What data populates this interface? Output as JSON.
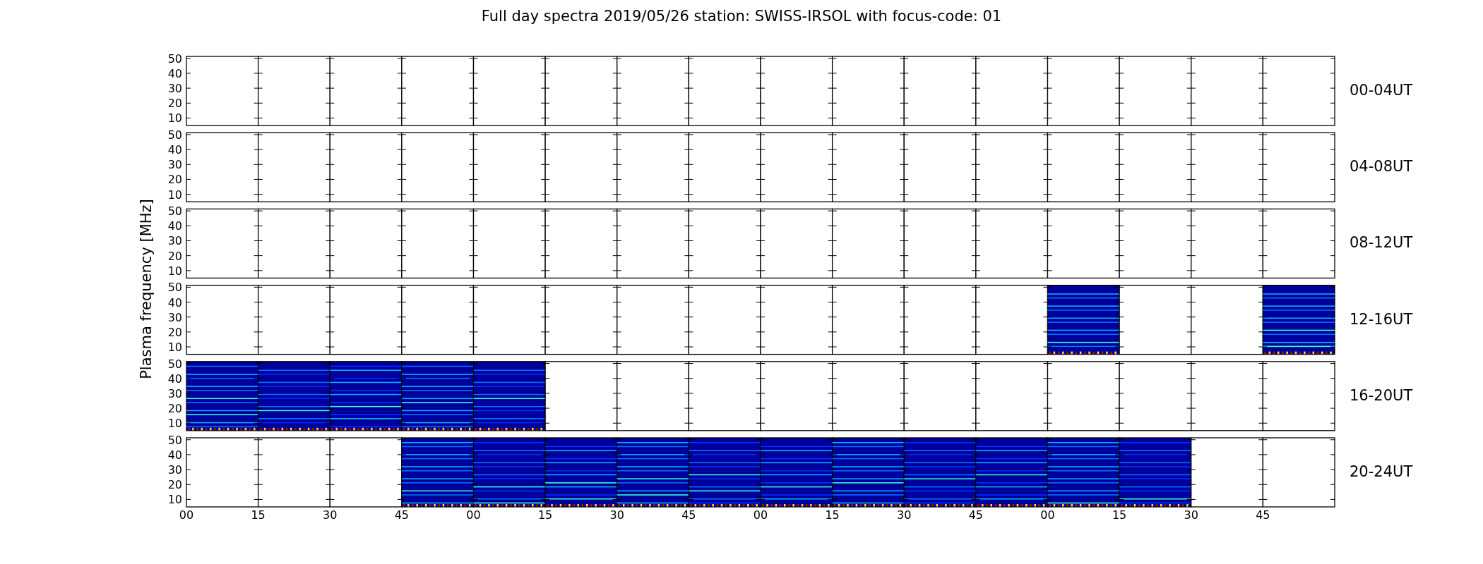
{
  "title": "Full day spectra 2019/05/26 station: SWISS-IRSOL with focus-code: 01",
  "ylabel": "Plasma frequency [MHz]",
  "panels": [
    {
      "label": "00-04UT",
      "yticks": [
        "50",
        "40",
        "30",
        "20",
        "10"
      ],
      "segments": [
        {
          "has_data": false
        },
        {
          "has_data": false
        },
        {
          "has_data": false
        },
        {
          "has_data": false
        },
        {
          "has_data": false
        },
        {
          "has_data": false
        },
        {
          "has_data": false
        },
        {
          "has_data": false
        },
        {
          "has_data": false
        },
        {
          "has_data": false
        },
        {
          "has_data": false
        },
        {
          "has_data": false
        },
        {
          "has_data": false
        },
        {
          "has_data": false
        },
        {
          "has_data": false
        },
        {
          "has_data": false
        }
      ]
    },
    {
      "label": "04-08UT",
      "yticks": [
        "50",
        "40",
        "30",
        "20",
        "10"
      ],
      "segments": [
        {
          "has_data": false
        },
        {
          "has_data": false
        },
        {
          "has_data": false
        },
        {
          "has_data": false
        },
        {
          "has_data": false
        },
        {
          "has_data": false
        },
        {
          "has_data": false
        },
        {
          "has_data": false
        },
        {
          "has_data": false
        },
        {
          "has_data": false
        },
        {
          "has_data": false
        },
        {
          "has_data": false
        },
        {
          "has_data": false
        },
        {
          "has_data": false
        },
        {
          "has_data": false
        },
        {
          "has_data": false
        }
      ]
    },
    {
      "label": "08-12UT",
      "yticks": [
        "50",
        "40",
        "30",
        "20",
        "10"
      ],
      "segments": [
        {
          "has_data": false
        },
        {
          "has_data": false
        },
        {
          "has_data": false
        },
        {
          "has_data": false
        },
        {
          "has_data": false
        },
        {
          "has_data": false
        },
        {
          "has_data": false
        },
        {
          "has_data": false
        },
        {
          "has_data": false
        },
        {
          "has_data": false
        },
        {
          "has_data": false
        },
        {
          "has_data": false
        },
        {
          "has_data": false
        },
        {
          "has_data": false
        },
        {
          "has_data": false
        },
        {
          "has_data": false
        }
      ]
    },
    {
      "label": "12-16UT",
      "yticks": [
        "50",
        "40",
        "30",
        "20",
        "10"
      ],
      "segments": [
        {
          "has_data": false
        },
        {
          "has_data": false
        },
        {
          "has_data": false
        },
        {
          "has_data": false
        },
        {
          "has_data": false
        },
        {
          "has_data": false
        },
        {
          "has_data": false
        },
        {
          "has_data": false
        },
        {
          "has_data": false
        },
        {
          "has_data": false
        },
        {
          "has_data": false
        },
        {
          "has_data": false
        },
        {
          "has_data": true
        },
        {
          "has_data": false
        },
        {
          "has_data": false
        },
        {
          "has_data": true
        }
      ]
    },
    {
      "label": "16-20UT",
      "yticks": [
        "50",
        "40",
        "30",
        "20",
        "10"
      ],
      "segments": [
        {
          "has_data": true
        },
        {
          "has_data": true
        },
        {
          "has_data": true
        },
        {
          "has_data": true
        },
        {
          "has_data": true
        },
        {
          "has_data": false
        },
        {
          "has_data": false
        },
        {
          "has_data": false
        },
        {
          "has_data": false
        },
        {
          "has_data": false
        },
        {
          "has_data": false
        },
        {
          "has_data": false
        },
        {
          "has_data": false
        },
        {
          "has_data": false
        },
        {
          "has_data": false
        },
        {
          "has_data": false
        }
      ]
    },
    {
      "label": "20-24UT",
      "yticks": [
        "50",
        "40",
        "30",
        "20",
        "10"
      ],
      "segments": [
        {
          "has_data": false
        },
        {
          "has_data": false
        },
        {
          "has_data": false
        },
        {
          "has_data": true
        },
        {
          "has_data": true
        },
        {
          "has_data": true
        },
        {
          "has_data": true
        },
        {
          "has_data": true
        },
        {
          "has_data": true
        },
        {
          "has_data": true
        },
        {
          "has_data": true
        },
        {
          "has_data": true
        },
        {
          "has_data": true
        },
        {
          "has_data": true
        },
        {
          "has_data": false
        },
        {
          "has_data": false
        }
      ]
    }
  ],
  "xticks": [
    "00",
    "15",
    "30",
    "45",
    "00",
    "15",
    "30",
    "45",
    "00",
    "15",
    "30",
    "45",
    "00",
    "15",
    "30",
    "45"
  ]
}
